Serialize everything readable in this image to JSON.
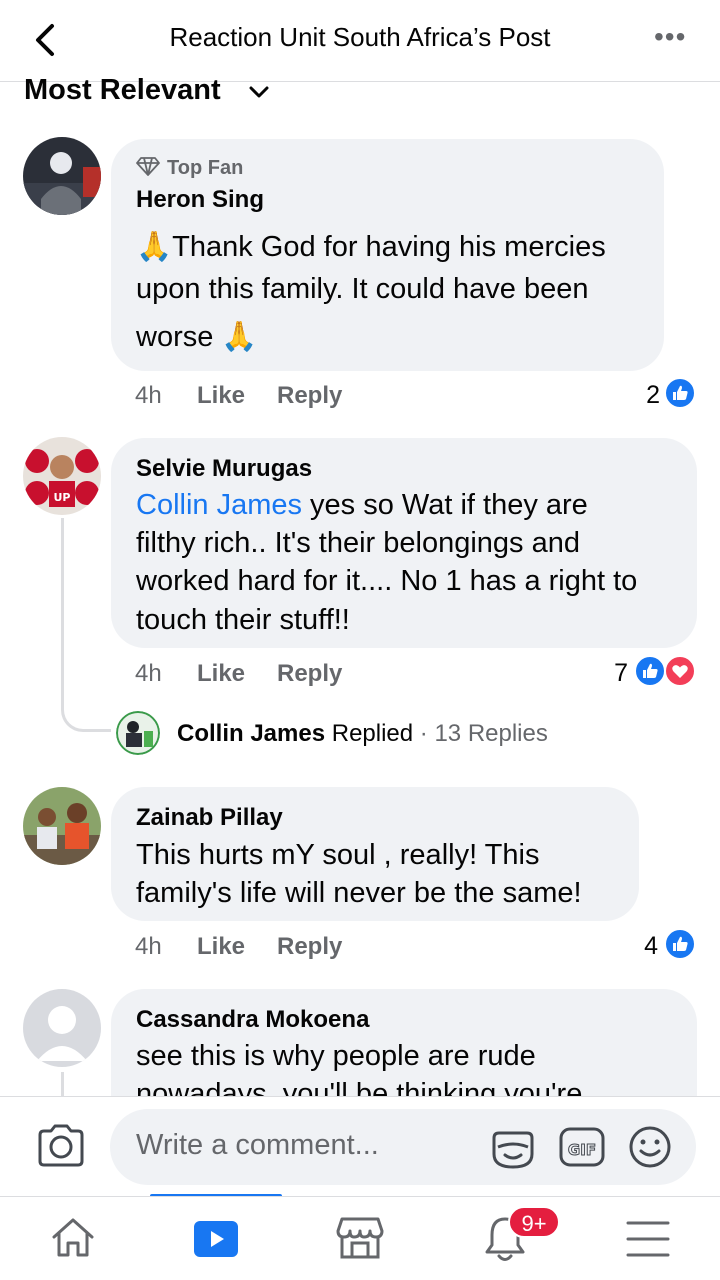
{
  "header": {
    "title": "Reaction Unit South Africa’s Post"
  },
  "sort": {
    "label": "Most Relevant"
  },
  "comments": [
    {
      "badge": "Top Fan",
      "author": "Heron Sing",
      "lines": [
        "🙏Thank God for having his mercies",
        "upon this family. It could have been",
        "worse 🙏"
      ],
      "time": "4h",
      "like": "Like",
      "reply": "Reply",
      "reactions": "2"
    },
    {
      "author": "Selvie Murugas",
      "mention": "Collin James",
      "lines": [
        " yes so Wat if they are",
        "filthy rich.. It's their belongings and",
        "worked hard for it.... No 1 has a right to",
        "touch their stuff!!"
      ],
      "time": "4h",
      "like": "Like",
      "reply": "Reply",
      "reactions": "7",
      "replied": {
        "name": "Collin James",
        "verb": "Replied",
        "count": "· 13 Replies"
      }
    },
    {
      "author": "Zainab Pillay",
      "lines": [
        "This hurts mY soul , really! This",
        "family's life will never be the same!"
      ],
      "time": "4h",
      "like": "Like",
      "reply": "Reply",
      "reactions": "4"
    },
    {
      "author": "Cassandra Mokoena",
      "lines": [
        "see this is why people are rude",
        "nowadays, you'll be thinking you're"
      ]
    }
  ],
  "composer": {
    "placeholder": "Write a comment..."
  },
  "tabbar": {
    "notifications_badge": "9+"
  },
  "colors": {
    "accent": "#1877f2",
    "love": "#f33e58",
    "bubble": "#f0f2f5",
    "muted": "#65676b"
  }
}
